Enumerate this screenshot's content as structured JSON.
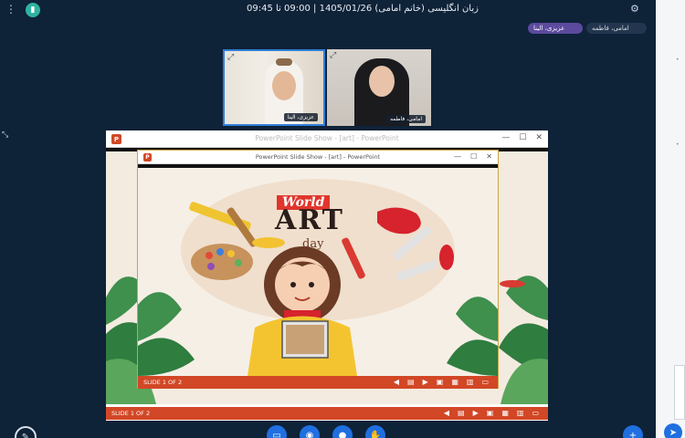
{
  "header": {
    "title": "زبان انگلیسی (خانم امامی) 1405/01/26 | 09:00 تا 09:45"
  },
  "participants": [
    {
      "label": "عزیزی، الینا",
      "accent": "#5b4a9e"
    },
    {
      "label": "امامی، فاطمه",
      "accent": "#24364f"
    }
  ],
  "webcams": [
    {
      "name": "عزیزی، الینا"
    },
    {
      "name": "امامی، فاطمه"
    }
  ],
  "outer_window": {
    "title": "PowerPoint Slide Show - [art] - PowerPoint",
    "status": "SLIDE 1 OF 2"
  },
  "inner_window": {
    "title": "PowerPoint Slide Show - [art] - PowerPoint",
    "status": "SLIDE 1 OF 2"
  },
  "slide": {
    "banner": "World",
    "headline": "ART",
    "subline": "day"
  },
  "colors": {
    "background": "#0e2238",
    "ppt_orange": "#d24726",
    "share_border": "#c9a640",
    "active_cam": "#2f7fd8"
  },
  "icons": {
    "pen": "pencil-icon",
    "send": "send-icon",
    "plus": "plus-icon"
  }
}
